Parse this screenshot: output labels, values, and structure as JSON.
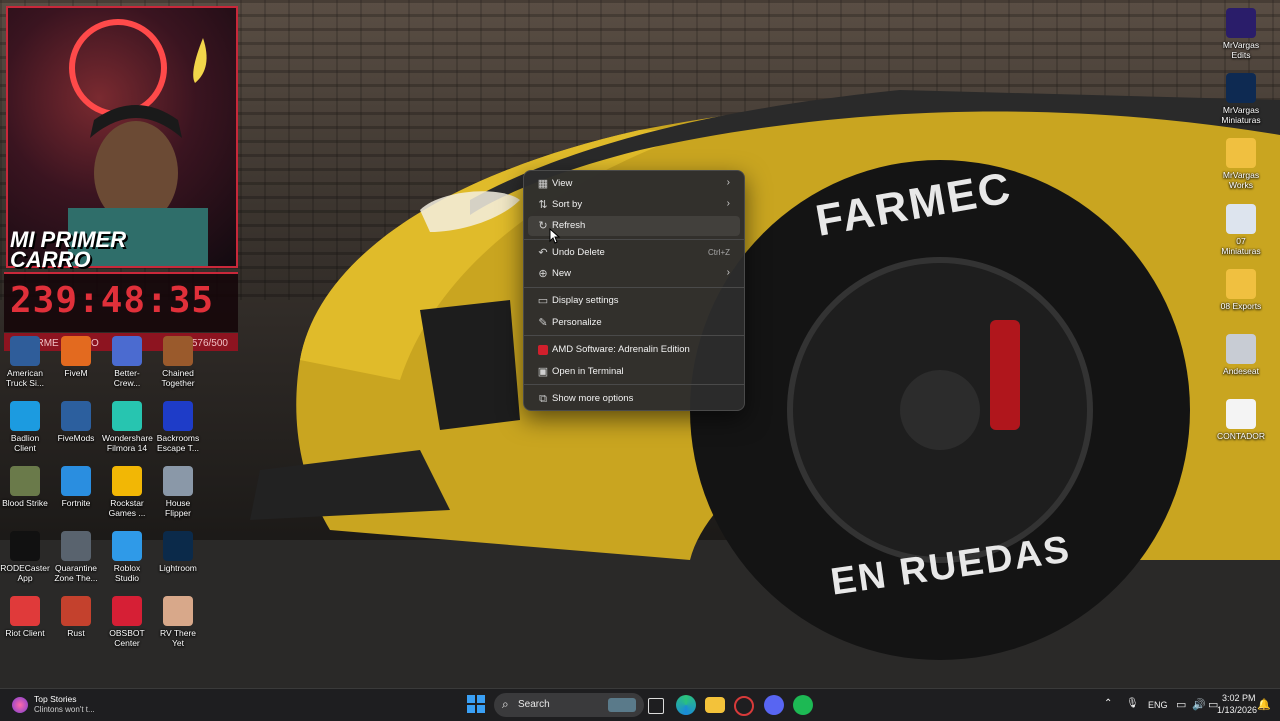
{
  "overlay": {
    "brand_text": "MI PRIMER CARRO",
    "timer": "239:48:35",
    "goal_label": "RAPARME A CACO",
    "goal_count": "576/500",
    "goal_progress": 1.0
  },
  "wallpaper": {
    "fender_text": "FARMEC",
    "tire_text": "EN RUEDAS"
  },
  "desktop_icons_left": [
    {
      "label": "American Truck Si...",
      "icon": "truck-icon",
      "color": "#2f5d9a"
    },
    {
      "label": "FiveM",
      "icon": "fivem-icon",
      "color": "#e36a1f"
    },
    {
      "label": "Better-Crew...",
      "icon": "better-crew-icon",
      "color": "#4b6bd0"
    },
    {
      "label": "Chained Together",
      "icon": "chain-icon",
      "color": "#9a5a2c"
    },
    {
      "label": "Badlion Client",
      "icon": "badlion-icon",
      "color": "#1c9be0"
    },
    {
      "label": "FiveMods",
      "icon": "fivemods-icon",
      "color": "#2c5f9e"
    },
    {
      "label": "Wondershare Filmora 14",
      "icon": "filmora-icon",
      "color": "#27c5b0"
    },
    {
      "label": "Backrooms Escape T...",
      "icon": "backrooms-icon",
      "color": "#1e3cc8"
    },
    {
      "label": "Blood Strike",
      "icon": "blood-strike-icon",
      "color": "#6a7a4a"
    },
    {
      "label": "Fortnite",
      "icon": "fortnite-icon",
      "color": "#2a8ee0"
    },
    {
      "label": "Rockstar Games ...",
      "icon": "rockstar-icon",
      "color": "#f2b705"
    },
    {
      "label": "House Flipper",
      "icon": "house-flipper-icon",
      "color": "#8a98a8"
    },
    {
      "label": "RODECaster App",
      "icon": "rodecaster-icon",
      "color": "#111111"
    },
    {
      "label": "Quarantine Zone The...",
      "icon": "quarantine-icon",
      "color": "#59636e"
    },
    {
      "label": "Roblox Studio",
      "icon": "roblox-studio-icon",
      "color": "#2f9ae8"
    },
    {
      "label": "Lightroom",
      "icon": "lightroom-icon",
      "color": "#0b2a4a"
    },
    {
      "label": "Riot Client",
      "icon": "riot-icon",
      "color": "#e03a3a"
    },
    {
      "label": "Rust",
      "icon": "rust-icon",
      "color": "#c4412d"
    },
    {
      "label": "OBSBOT Center",
      "icon": "obsbot-icon",
      "color": "#d61f35"
    },
    {
      "label": "RV There Yet",
      "icon": "rv-icon",
      "color": "#d8a88a"
    }
  ],
  "desktop_icons_right": [
    {
      "label": "MrVargas Edits",
      "icon": "premiere-icon",
      "color": "#2a1d6a"
    },
    {
      "label": "MrVargas Miniaturas",
      "icon": "photoshop-icon",
      "color": "#0e2a52"
    },
    {
      "label": "MrVargas Works",
      "icon": "folder-icon",
      "color": "#f0c040"
    },
    {
      "label": "07 Miniaturas",
      "icon": "photo-file-icon",
      "color": "#dde4ee"
    },
    {
      "label": "08 Exports",
      "icon": "folder-icon",
      "color": "#f0c040"
    },
    {
      "label": "Andeseat",
      "icon": "image-file-icon",
      "color": "#c8ccd4"
    },
    {
      "label": "CONTADOR",
      "icon": "text-file-icon",
      "color": "#f4f4f4"
    }
  ],
  "context_menu": {
    "items": [
      {
        "label": "View",
        "icon": "view-icon",
        "shortcut": "",
        "submenu": true
      },
      {
        "label": "Sort by",
        "icon": "sort-icon",
        "shortcut": "",
        "submenu": true
      },
      {
        "label": "Refresh",
        "icon": "refresh-icon",
        "shortcut": "",
        "submenu": false
      },
      {
        "label": "Undo Delete",
        "icon": "undo-icon",
        "shortcut": "Ctrl+Z",
        "submenu": false
      },
      {
        "label": "New",
        "icon": "new-icon",
        "shortcut": "",
        "submenu": true
      },
      {
        "label": "Display settings",
        "icon": "display-icon",
        "shortcut": "",
        "submenu": false
      },
      {
        "label": "Personalize",
        "icon": "brush-icon",
        "shortcut": "",
        "submenu": false
      },
      {
        "label": "AMD Software: Adrenalin Edition",
        "icon": "amd-icon",
        "shortcut": "",
        "submenu": false
      },
      {
        "label": "Open in Terminal",
        "icon": "terminal-icon",
        "shortcut": "",
        "submenu": false
      },
      {
        "label": "Show more options",
        "icon": "more-options-icon",
        "shortcut": "",
        "submenu": false
      }
    ]
  },
  "taskbar": {
    "news_title": "Top Stories",
    "news_subtitle": "Clintons won't t...",
    "search_placeholder": "Search",
    "language": "ENG",
    "time": "3:02 PM",
    "date": "1/13/2026"
  }
}
